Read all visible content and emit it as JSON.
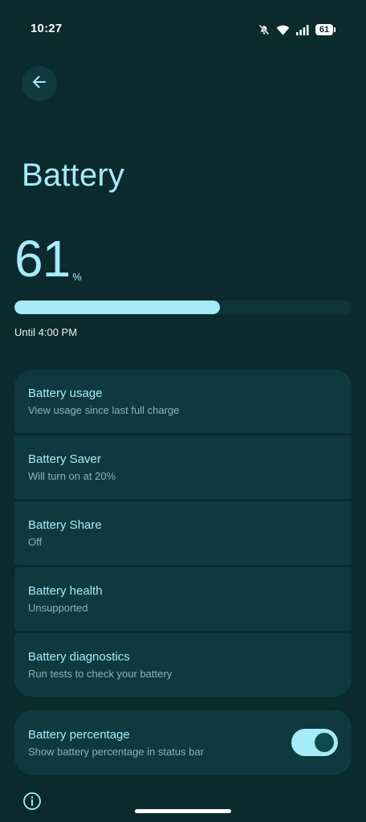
{
  "status_bar": {
    "time": "10:27",
    "battery_level": "61",
    "icons": [
      "mute-icon",
      "wifi-icon",
      "signal-icon",
      "battery-icon"
    ]
  },
  "header": {
    "back_icon": "arrow-left-icon",
    "title": "Battery"
  },
  "battery": {
    "level": "61",
    "unit": "%",
    "fill_fraction": 0.61,
    "remaining": "Until 4:00 PM"
  },
  "settings": {
    "items": [
      {
        "title": "Battery usage",
        "subtitle": "View usage since last full charge"
      },
      {
        "title": "Battery Saver",
        "subtitle": "Will turn on at 20%"
      },
      {
        "title": "Battery Share",
        "subtitle": "Off"
      },
      {
        "title": "Battery health",
        "subtitle": "Unsupported"
      },
      {
        "title": "Battery diagnostics",
        "subtitle": "Run tests to check your battery"
      }
    ]
  },
  "percentage_toggle": {
    "title": "Battery percentage",
    "subtitle": "Show battery percentage in status bar",
    "enabled": true
  },
  "footer": {
    "info_icon": "info-icon"
  },
  "colors": {
    "background": "#0a2a2e",
    "card": "#0e3a3f",
    "accent": "#a6ecf8",
    "subtitle": "#8fb0b3"
  }
}
